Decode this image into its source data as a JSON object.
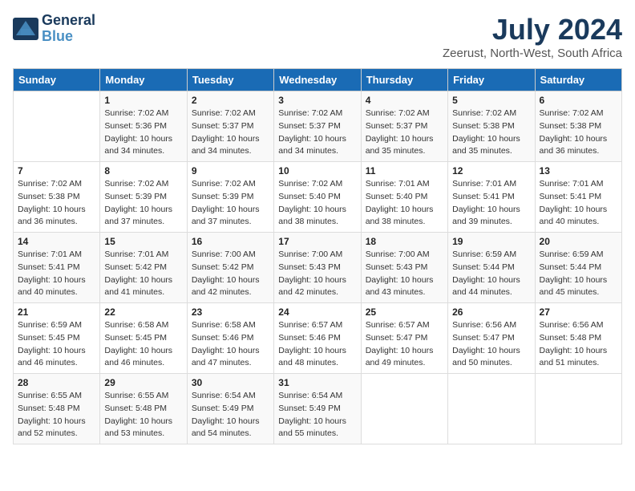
{
  "header": {
    "logo_line1": "General",
    "logo_line2": "Blue",
    "title": "July 2024",
    "subtitle": "Zeerust, North-West, South Africa"
  },
  "days_of_week": [
    "Sunday",
    "Monday",
    "Tuesday",
    "Wednesday",
    "Thursday",
    "Friday",
    "Saturday"
  ],
  "weeks": [
    [
      {
        "day": "",
        "info": ""
      },
      {
        "day": "1",
        "info": "Sunrise: 7:02 AM\nSunset: 5:36 PM\nDaylight: 10 hours\nand 34 minutes."
      },
      {
        "day": "2",
        "info": "Sunrise: 7:02 AM\nSunset: 5:37 PM\nDaylight: 10 hours\nand 34 minutes."
      },
      {
        "day": "3",
        "info": "Sunrise: 7:02 AM\nSunset: 5:37 PM\nDaylight: 10 hours\nand 34 minutes."
      },
      {
        "day": "4",
        "info": "Sunrise: 7:02 AM\nSunset: 5:37 PM\nDaylight: 10 hours\nand 35 minutes."
      },
      {
        "day": "5",
        "info": "Sunrise: 7:02 AM\nSunset: 5:38 PM\nDaylight: 10 hours\nand 35 minutes."
      },
      {
        "day": "6",
        "info": "Sunrise: 7:02 AM\nSunset: 5:38 PM\nDaylight: 10 hours\nand 36 minutes."
      }
    ],
    [
      {
        "day": "7",
        "info": "Sunrise: 7:02 AM\nSunset: 5:38 PM\nDaylight: 10 hours\nand 36 minutes."
      },
      {
        "day": "8",
        "info": "Sunrise: 7:02 AM\nSunset: 5:39 PM\nDaylight: 10 hours\nand 37 minutes."
      },
      {
        "day": "9",
        "info": "Sunrise: 7:02 AM\nSunset: 5:39 PM\nDaylight: 10 hours\nand 37 minutes."
      },
      {
        "day": "10",
        "info": "Sunrise: 7:02 AM\nSunset: 5:40 PM\nDaylight: 10 hours\nand 38 minutes."
      },
      {
        "day": "11",
        "info": "Sunrise: 7:01 AM\nSunset: 5:40 PM\nDaylight: 10 hours\nand 38 minutes."
      },
      {
        "day": "12",
        "info": "Sunrise: 7:01 AM\nSunset: 5:41 PM\nDaylight: 10 hours\nand 39 minutes."
      },
      {
        "day": "13",
        "info": "Sunrise: 7:01 AM\nSunset: 5:41 PM\nDaylight: 10 hours\nand 40 minutes."
      }
    ],
    [
      {
        "day": "14",
        "info": "Sunrise: 7:01 AM\nSunset: 5:41 PM\nDaylight: 10 hours\nand 40 minutes."
      },
      {
        "day": "15",
        "info": "Sunrise: 7:01 AM\nSunset: 5:42 PM\nDaylight: 10 hours\nand 41 minutes."
      },
      {
        "day": "16",
        "info": "Sunrise: 7:00 AM\nSunset: 5:42 PM\nDaylight: 10 hours\nand 42 minutes."
      },
      {
        "day": "17",
        "info": "Sunrise: 7:00 AM\nSunset: 5:43 PM\nDaylight: 10 hours\nand 42 minutes."
      },
      {
        "day": "18",
        "info": "Sunrise: 7:00 AM\nSunset: 5:43 PM\nDaylight: 10 hours\nand 43 minutes."
      },
      {
        "day": "19",
        "info": "Sunrise: 6:59 AM\nSunset: 5:44 PM\nDaylight: 10 hours\nand 44 minutes."
      },
      {
        "day": "20",
        "info": "Sunrise: 6:59 AM\nSunset: 5:44 PM\nDaylight: 10 hours\nand 45 minutes."
      }
    ],
    [
      {
        "day": "21",
        "info": "Sunrise: 6:59 AM\nSunset: 5:45 PM\nDaylight: 10 hours\nand 46 minutes."
      },
      {
        "day": "22",
        "info": "Sunrise: 6:58 AM\nSunset: 5:45 PM\nDaylight: 10 hours\nand 46 minutes."
      },
      {
        "day": "23",
        "info": "Sunrise: 6:58 AM\nSunset: 5:46 PM\nDaylight: 10 hours\nand 47 minutes."
      },
      {
        "day": "24",
        "info": "Sunrise: 6:57 AM\nSunset: 5:46 PM\nDaylight: 10 hours\nand 48 minutes."
      },
      {
        "day": "25",
        "info": "Sunrise: 6:57 AM\nSunset: 5:47 PM\nDaylight: 10 hours\nand 49 minutes."
      },
      {
        "day": "26",
        "info": "Sunrise: 6:56 AM\nSunset: 5:47 PM\nDaylight: 10 hours\nand 50 minutes."
      },
      {
        "day": "27",
        "info": "Sunrise: 6:56 AM\nSunset: 5:48 PM\nDaylight: 10 hours\nand 51 minutes."
      }
    ],
    [
      {
        "day": "28",
        "info": "Sunrise: 6:55 AM\nSunset: 5:48 PM\nDaylight: 10 hours\nand 52 minutes."
      },
      {
        "day": "29",
        "info": "Sunrise: 6:55 AM\nSunset: 5:48 PM\nDaylight: 10 hours\nand 53 minutes."
      },
      {
        "day": "30",
        "info": "Sunrise: 6:54 AM\nSunset: 5:49 PM\nDaylight: 10 hours\nand 54 minutes."
      },
      {
        "day": "31",
        "info": "Sunrise: 6:54 AM\nSunset: 5:49 PM\nDaylight: 10 hours\nand 55 minutes."
      },
      {
        "day": "",
        "info": ""
      },
      {
        "day": "",
        "info": ""
      },
      {
        "day": "",
        "info": ""
      }
    ]
  ]
}
